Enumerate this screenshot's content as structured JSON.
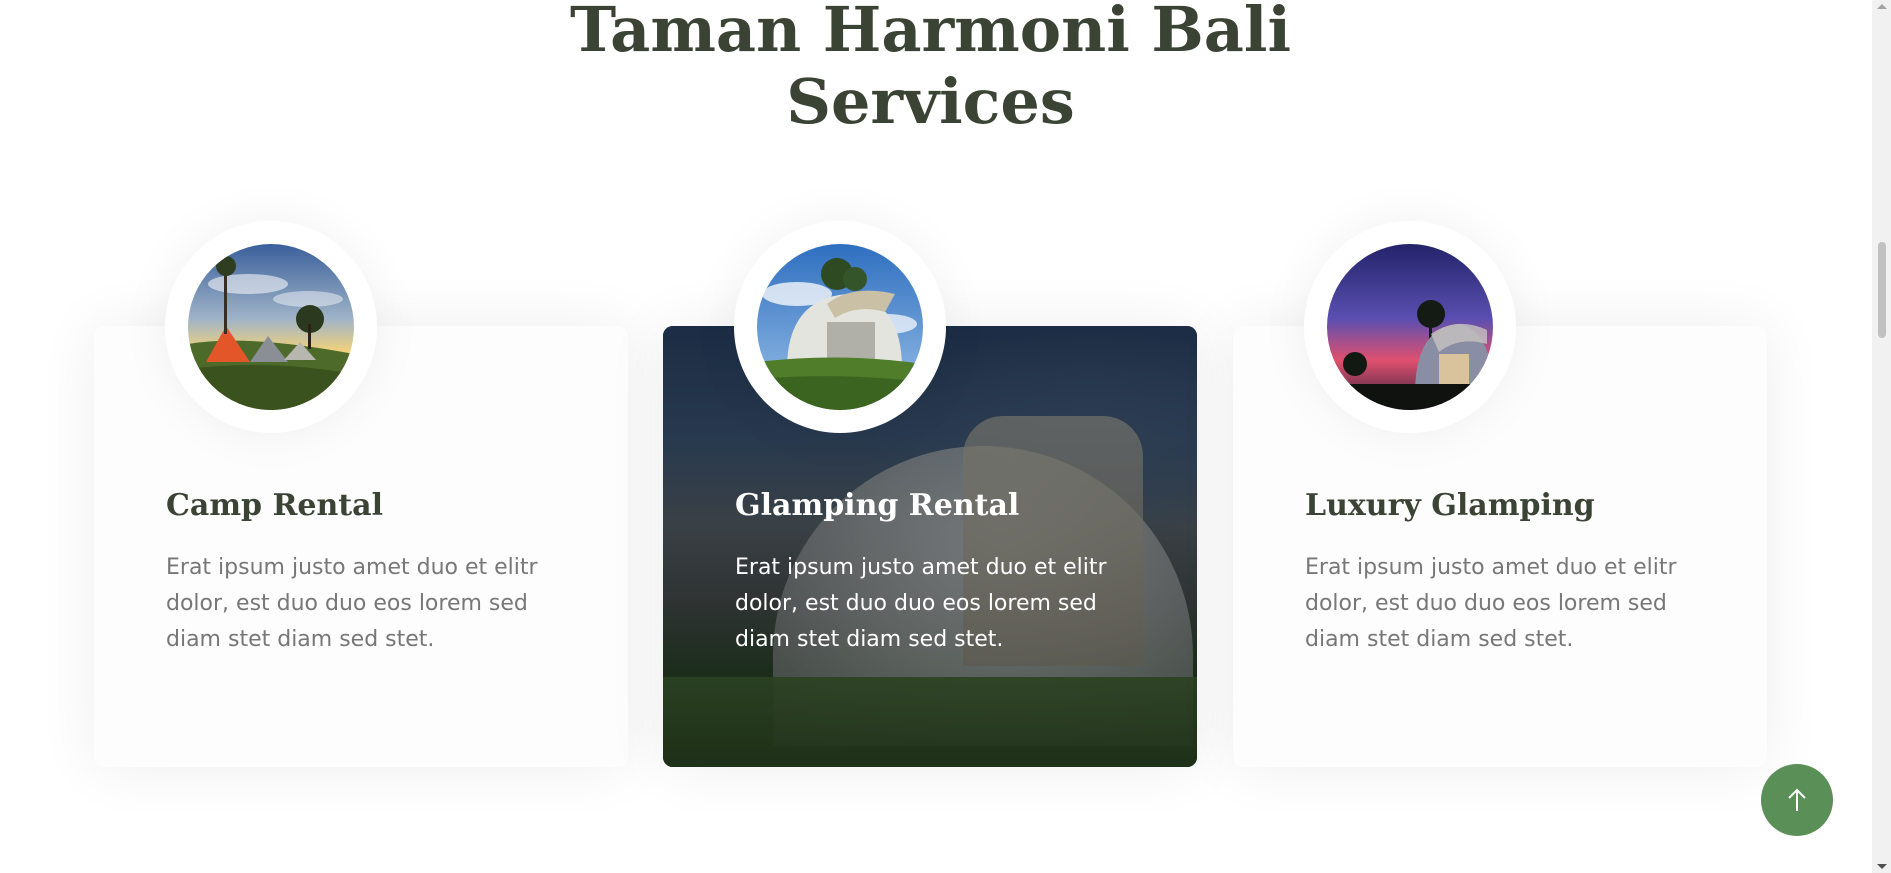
{
  "section": {
    "title_line1": "Taman Harmoni Bali",
    "title_line2": "Services"
  },
  "cards": [
    {
      "title": "Camp Rental",
      "text": "Erat ipsum justo amet duo et elitr dolor, est duo duo eos lorem sed diam stet diam sed stet.",
      "image": "camp-tent-sunset-photo",
      "active": false
    },
    {
      "title": "Glamping Rental",
      "text": "Erat ipsum justo amet duo et elitr dolor, est duo duo eos lorem sed diam stet diam sed stet.",
      "image": "glamping-dome-photo",
      "active": true
    },
    {
      "title": "Luxury Glamping",
      "text": "Erat ipsum justo amet duo et elitr dolor, est duo duo eos lorem sed diam stet diam sed stet.",
      "image": "luxury-dome-night-photo",
      "active": false
    }
  ],
  "back_to_top": {
    "icon": "arrow-up-icon"
  },
  "colors": {
    "heading": "#3b4335",
    "body_text": "#777777",
    "accent_green": "#5a8f57",
    "background": "#ffffff"
  }
}
